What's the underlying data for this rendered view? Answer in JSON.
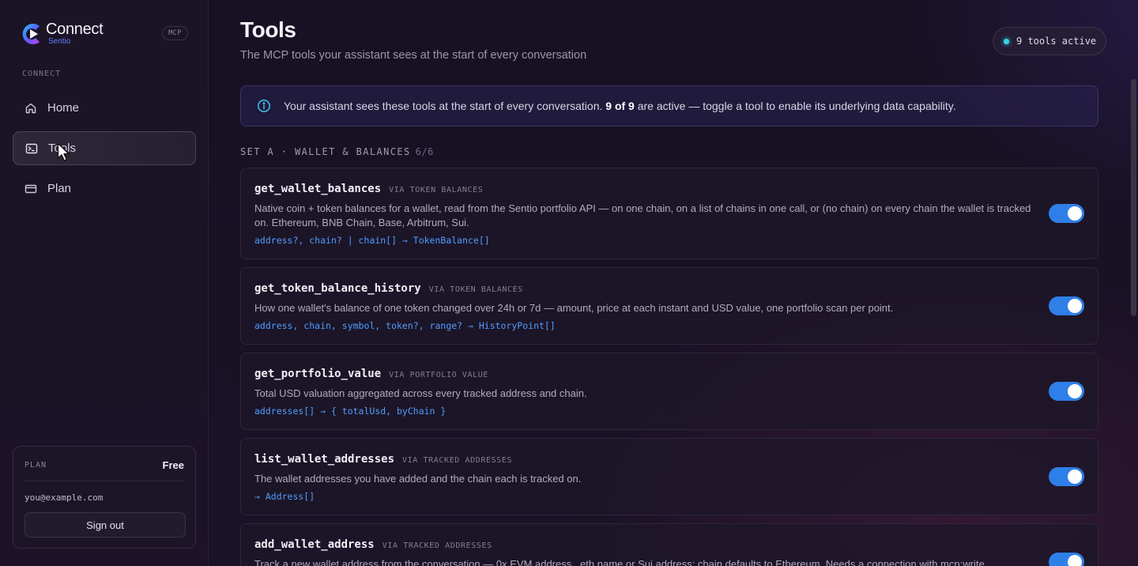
{
  "brand": {
    "name": "Connect",
    "sub": "Sentio",
    "badge": "MCP"
  },
  "sidebar": {
    "section_label": "CONNECT",
    "items": [
      {
        "label": "Home",
        "icon": "home-icon",
        "active": false
      },
      {
        "label": "Tools",
        "icon": "terminal-icon",
        "active": true
      },
      {
        "label": "Plan",
        "icon": "credit-card-icon",
        "active": false
      }
    ],
    "plan": {
      "label": "PLAN",
      "value": "Free",
      "email": "you@example.com",
      "signout_label": "Sign out"
    }
  },
  "header": {
    "title": "Tools",
    "subtitle": "The MCP tools your assistant sees at the start of every conversation",
    "active_pill": "9 tools active"
  },
  "banner": {
    "text_before": "Your assistant sees these tools at the start of every conversation. ",
    "text_bold": "9 of 9",
    "text_after": " are active — toggle a tool to enable its underlying data capability."
  },
  "set": {
    "label": "SET A · WALLET & BALANCES",
    "count": "6/6"
  },
  "tools": [
    {
      "name": "get_wallet_balances",
      "via": "VIA TOKEN BALANCES",
      "description": "Native coin + token balances for a wallet, read from the Sentio portfolio API — on one chain, on a list of chains in one call, or (no chain) on every chain the wallet is tracked on. Ethereum, BNB Chain, Base, Arbitrum, Sui.",
      "signature": "address?, chain? | chain[] → TokenBalance[]",
      "enabled": true
    },
    {
      "name": "get_token_balance_history",
      "via": "VIA TOKEN BALANCES",
      "description": "How one wallet's balance of one token changed over 24h or 7d — amount, price at each instant and USD value, one portfolio scan per point.",
      "signature": "address, chain, symbol, token?, range? → HistoryPoint[]",
      "enabled": true
    },
    {
      "name": "get_portfolio_value",
      "via": "VIA PORTFOLIO VALUE",
      "description": "Total USD valuation aggregated across every tracked address and chain.",
      "signature": "addresses[] → { totalUsd, byChain }",
      "enabled": true
    },
    {
      "name": "list_wallet_addresses",
      "via": "VIA TRACKED ADDRESSES",
      "description": "The wallet addresses you have added and the chain each is tracked on.",
      "signature": "→ Address[]",
      "enabled": true
    },
    {
      "name": "add_wallet_address",
      "via": "VIA TRACKED ADDRESSES",
      "description": "Track a new wallet address from the conversation — 0x EVM address, .eth name or Sui address; chain defaults to Ethereum. Needs a connection with mcp:write.",
      "signature": "",
      "enabled": true
    }
  ],
  "colors": {
    "accent": "#2f7fe8",
    "signature": "#4f9dff",
    "active_dot": "#3ad4e6"
  }
}
